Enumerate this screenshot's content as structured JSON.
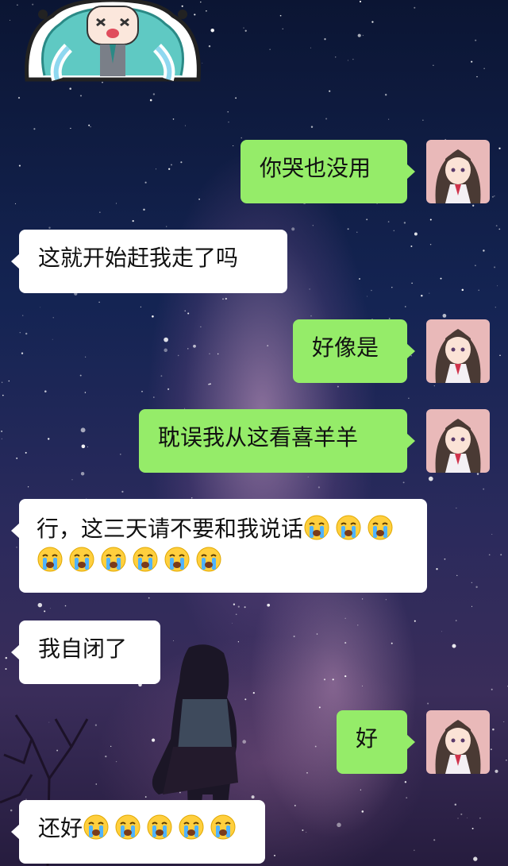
{
  "chat": {
    "sticker": "crying-anime-girl-sticker",
    "emoji_icon": "loudly-crying-emoji",
    "colors": {
      "sent": "#95ec69",
      "received": "#ffffff"
    },
    "messages": [
      {
        "side": "right",
        "text": "你哭也没用"
      },
      {
        "side": "left",
        "text": "这就开始赶我走了吗"
      },
      {
        "side": "right",
        "text": "好像是"
      },
      {
        "side": "right",
        "text": "耽误我从这看喜羊羊"
      },
      {
        "side": "left",
        "text": "行，这三天请不要和我说话",
        "emoji_count": 9
      },
      {
        "side": "left",
        "text": "我自闭了"
      },
      {
        "side": "right",
        "text": "好"
      },
      {
        "side": "left",
        "text": "还好",
        "emoji_count": 5
      }
    ]
  }
}
